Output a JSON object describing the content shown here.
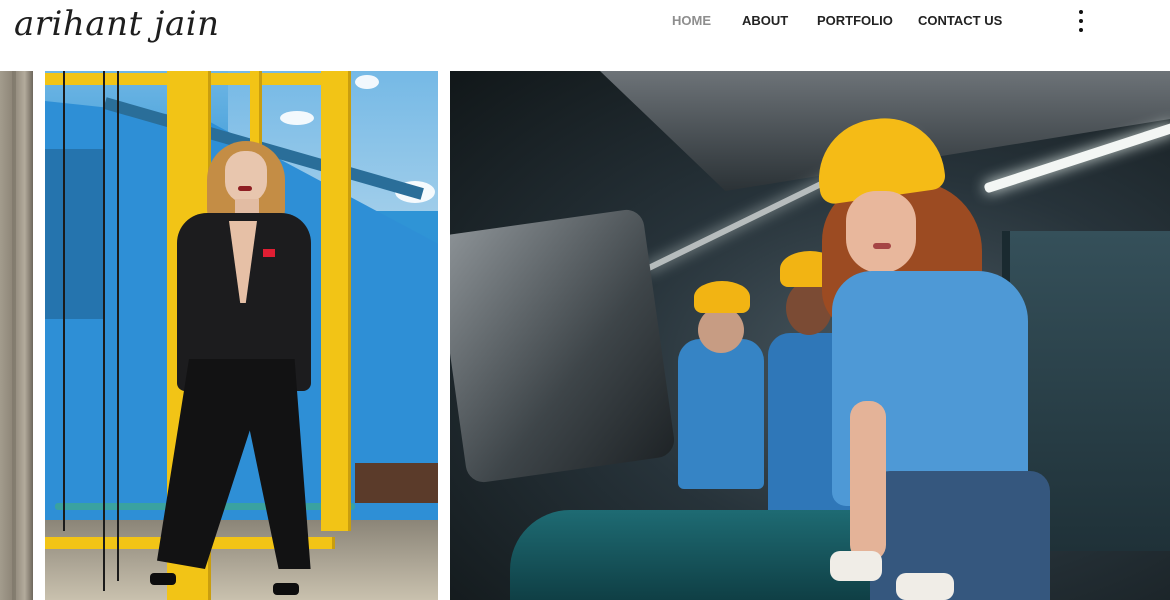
{
  "brand": {
    "logo_text": "arihant jain"
  },
  "nav": {
    "items": [
      {
        "label": "HOME",
        "active": true
      },
      {
        "label": "ABOUT",
        "active": false
      },
      {
        "label": "PORTFOLIO",
        "active": false
      },
      {
        "label": "CONTACT US",
        "active": false
      }
    ],
    "menu_icon": "vertical-ellipsis-icon"
  },
  "colors": {
    "nav_text": "#222222",
    "nav_active": "#8e8e8e",
    "background": "#ffffff"
  },
  "gallery": {
    "photos": [
      {
        "subject": "partial-photo"
      },
      {
        "subject": "woman-in-black-suit-with-yellow-scaffolding"
      },
      {
        "subject": "industrial-workers-with-yellow-helmets"
      }
    ]
  }
}
